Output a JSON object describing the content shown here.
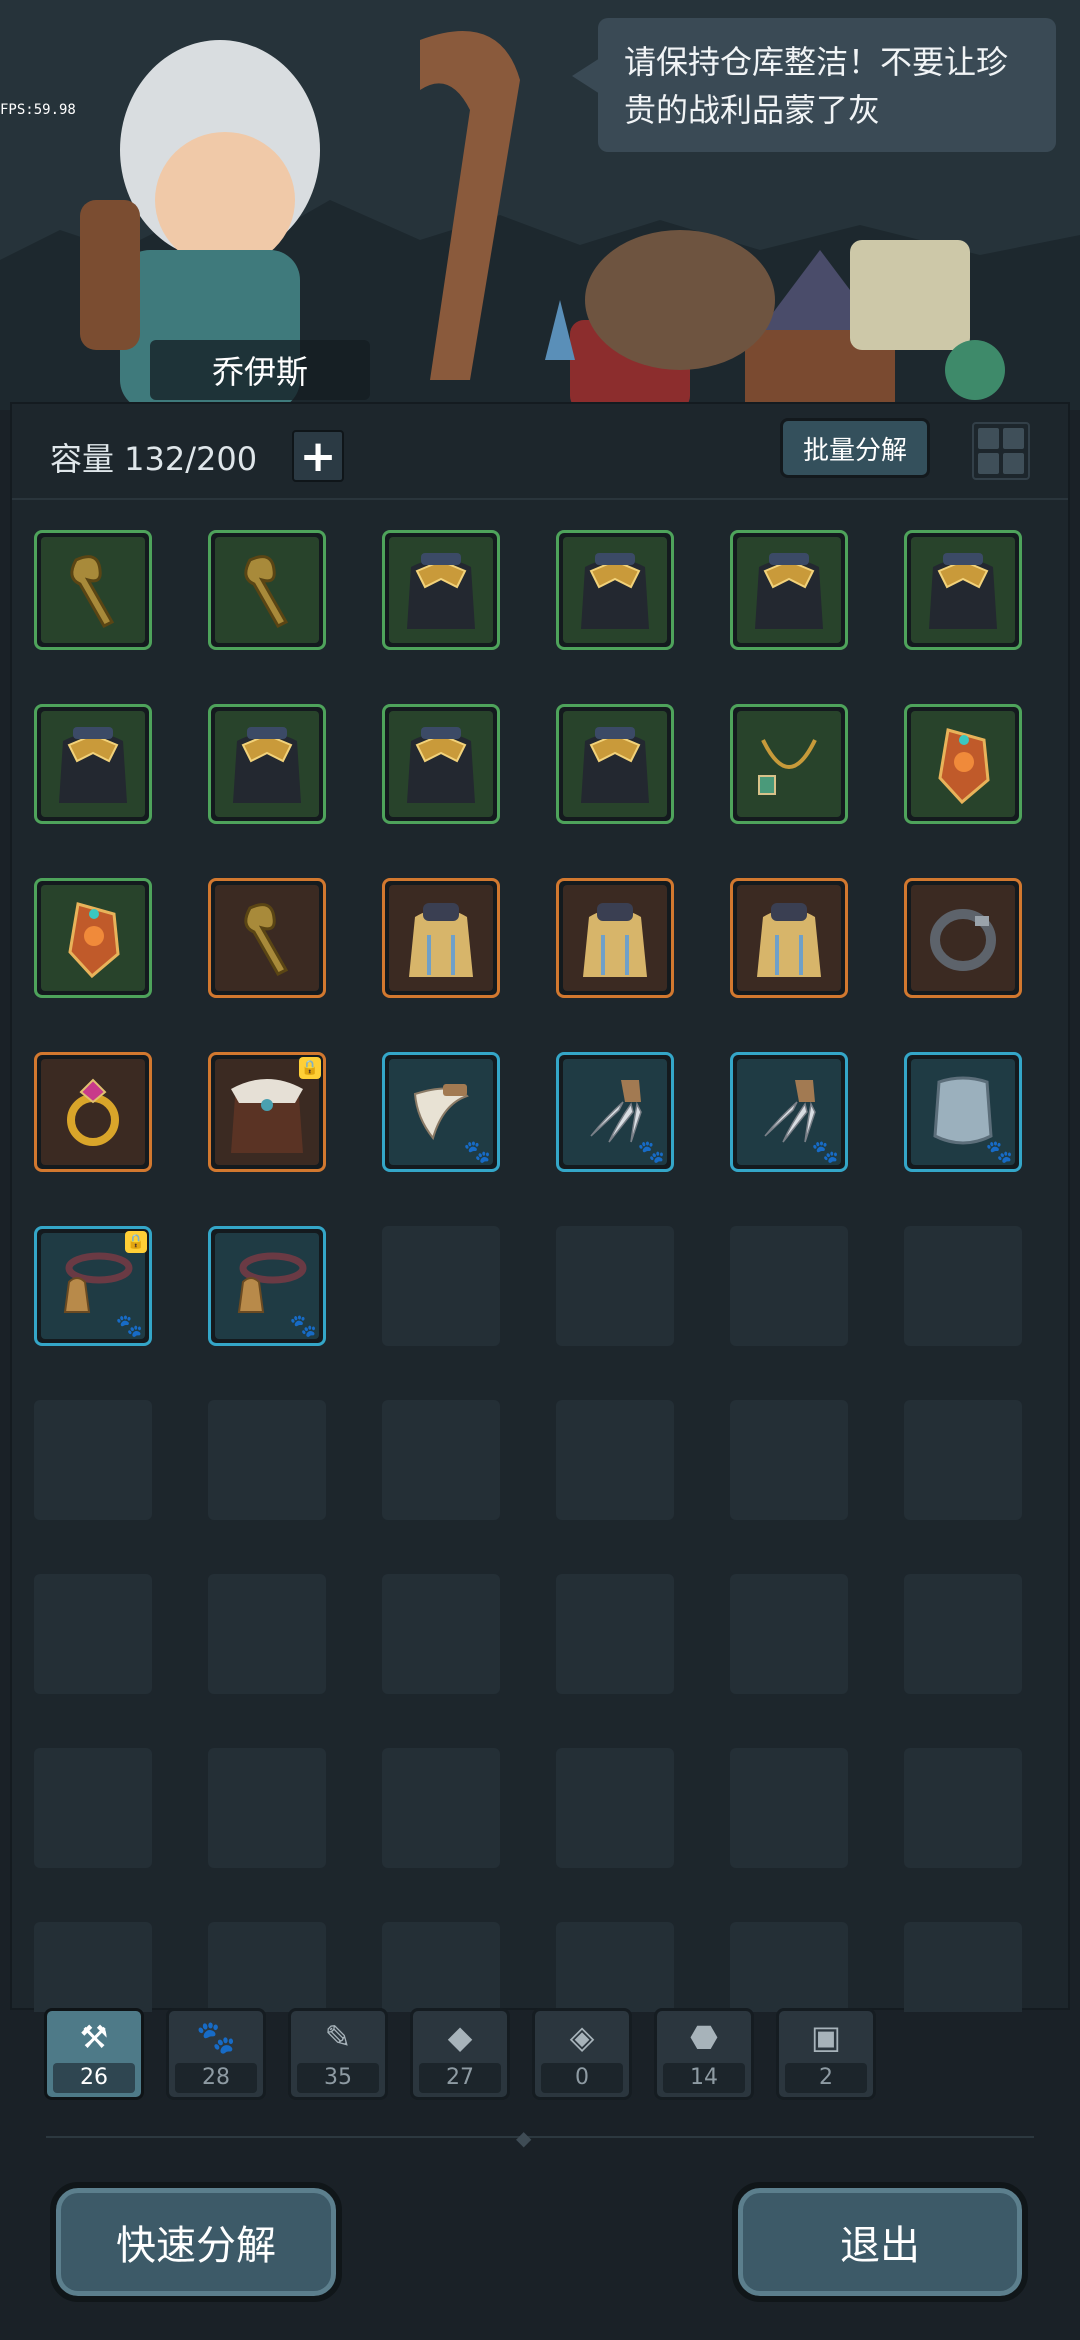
{
  "hud": {
    "fps": "FPS:59.98"
  },
  "npc": {
    "name": "乔伊斯",
    "speech": "请保持仓库整洁！不要让珍贵的战利品蒙了灰"
  },
  "header": {
    "capacity_label": "容量 132/200",
    "add_capacity_icon": "plus-icon",
    "batch_button_label": "批量分解",
    "view_toggle_icon": "grid-view-icon"
  },
  "inventory": {
    "rows": [
      [
        {
          "rarity": "green",
          "icon": "staff-icon",
          "locked": false,
          "pet": false
        },
        {
          "rarity": "green",
          "icon": "staff-icon",
          "locked": false,
          "pet": false
        },
        {
          "rarity": "green",
          "icon": "cloak-icon",
          "locked": false,
          "pet": false
        },
        {
          "rarity": "green",
          "icon": "cloak-icon",
          "locked": false,
          "pet": false
        },
        {
          "rarity": "green",
          "icon": "cloak-icon",
          "locked": false,
          "pet": false
        },
        {
          "rarity": "green",
          "icon": "cloak-icon",
          "locked": false,
          "pet": false
        }
      ],
      [
        {
          "rarity": "green",
          "icon": "cloak-icon",
          "locked": false,
          "pet": false
        },
        {
          "rarity": "green",
          "icon": "cloak-icon",
          "locked": false,
          "pet": false
        },
        {
          "rarity": "green",
          "icon": "cloak-icon",
          "locked": false,
          "pet": false
        },
        {
          "rarity": "green",
          "icon": "cloak-icon",
          "locked": false,
          "pet": false
        },
        {
          "rarity": "green",
          "icon": "necklace-icon",
          "locked": false,
          "pet": false
        },
        {
          "rarity": "green",
          "icon": "gem-charm-icon",
          "locked": false,
          "pet": false
        }
      ],
      [
        {
          "rarity": "green",
          "icon": "gem-charm-icon",
          "locked": false,
          "pet": false
        },
        {
          "rarity": "orange",
          "icon": "staff-icon",
          "locked": false,
          "pet": false
        },
        {
          "rarity": "orange",
          "icon": "robe-icon",
          "locked": false,
          "pet": false
        },
        {
          "rarity": "orange",
          "icon": "robe-icon",
          "locked": false,
          "pet": false
        },
        {
          "rarity": "orange",
          "icon": "robe-icon",
          "locked": false,
          "pet": false
        },
        {
          "rarity": "orange",
          "icon": "ring-icon",
          "locked": false,
          "pet": false
        }
      ],
      [
        {
          "rarity": "orange",
          "icon": "gold-ring-icon",
          "locked": false,
          "pet": false
        },
        {
          "rarity": "orange",
          "icon": "fur-armor-icon",
          "locked": true,
          "pet": false
        },
        {
          "rarity": "blue",
          "icon": "fang-icon",
          "locked": false,
          "pet": true
        },
        {
          "rarity": "blue",
          "icon": "claws-icon",
          "locked": false,
          "pet": true
        },
        {
          "rarity": "blue",
          "icon": "claws-icon",
          "locked": false,
          "pet": true
        },
        {
          "rarity": "blue",
          "icon": "pet-armor-icon",
          "locked": false,
          "pet": true
        }
      ],
      [
        {
          "rarity": "blue",
          "icon": "bell-collar-icon",
          "locked": true,
          "pet": true
        },
        {
          "rarity": "blue",
          "icon": "bell-collar-icon",
          "locked": false,
          "pet": true
        },
        null,
        null,
        null,
        null
      ],
      [
        null,
        null,
        null,
        null,
        null,
        null
      ],
      [
        null,
        null,
        null,
        null,
        null,
        null
      ],
      [
        null,
        null,
        null,
        null,
        null,
        null
      ],
      [
        null,
        null,
        null,
        null,
        null,
        null
      ]
    ]
  },
  "tabs": [
    {
      "icon": "weapon-tools-icon",
      "count": "26",
      "active": true
    },
    {
      "icon": "paw-icon",
      "count": "28",
      "active": false
    },
    {
      "icon": "scroll-icon",
      "count": "35",
      "active": false
    },
    {
      "icon": "diamond-icon",
      "count": "27",
      "active": false
    },
    {
      "icon": "rune-stone-icon",
      "count": "0",
      "active": false
    },
    {
      "icon": "ore-icon",
      "count": "14",
      "active": false
    },
    {
      "icon": "chest-icon",
      "count": "2",
      "active": false
    }
  ],
  "footer": {
    "quick_decompose_label": "快速分解",
    "exit_label": "退出"
  },
  "colors": {
    "green_rarity": "#4ea35b",
    "orange_rarity": "#d2782f",
    "blue_rarity": "#34a6c8",
    "button": "#3d5a68",
    "background": "#1a2127"
  }
}
